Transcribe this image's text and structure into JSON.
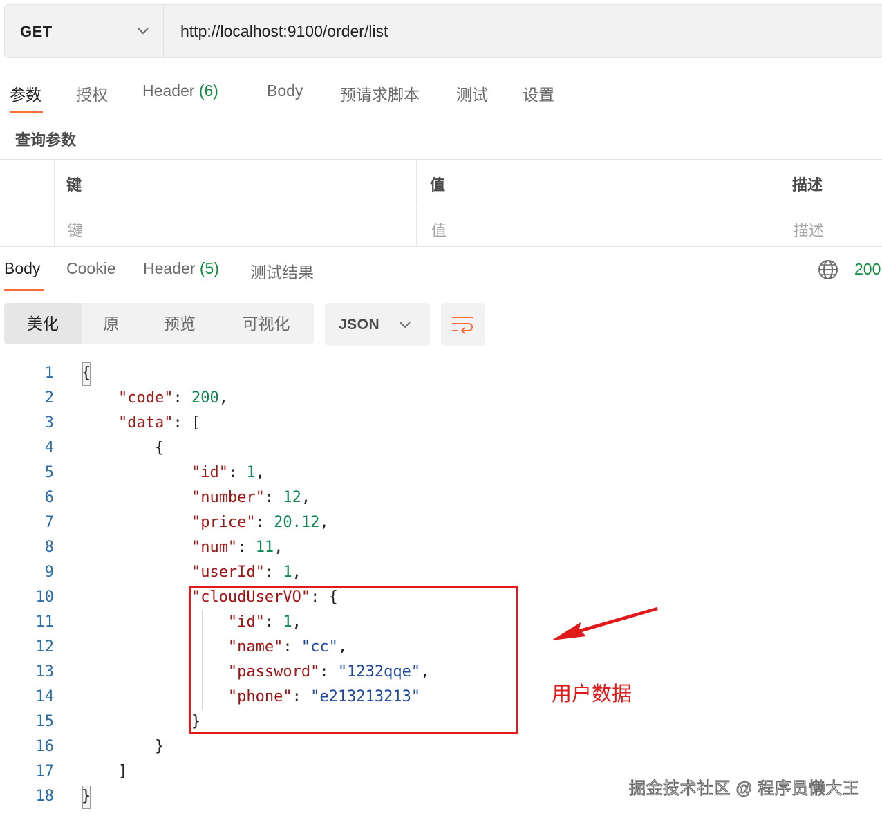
{
  "request": {
    "method": "GET",
    "url": "http://localhost:9100/order/list",
    "tabs": [
      {
        "label": "参数"
      },
      {
        "label": "授权"
      },
      {
        "label": "Header",
        "count": "(6)"
      },
      {
        "label": "Body"
      },
      {
        "label": "预请求脚本"
      },
      {
        "label": "测试"
      },
      {
        "label": "设置"
      }
    ],
    "active_tab": "参数"
  },
  "params": {
    "title": "查询参数",
    "headers": [
      "键",
      "值",
      "描述"
    ],
    "placeholders": [
      "键",
      "值",
      "描述"
    ]
  },
  "response": {
    "tabs": [
      {
        "label": "Body"
      },
      {
        "label": "Cookie"
      },
      {
        "label": "Header",
        "count": "(5)"
      },
      {
        "label": "测试结果"
      }
    ],
    "active_tab": "Body",
    "status": "200",
    "view_modes": [
      "美化",
      "原",
      "预览",
      "可视化"
    ],
    "active_view_mode": "美化",
    "format": "JSON",
    "icons": [
      "globe-icon",
      "chevron-down-icon",
      "wrap-lines-icon"
    ],
    "code_lines": [
      {
        "n": "1",
        "text": "{"
      },
      {
        "n": "2",
        "text": "    \"code\": 200,"
      },
      {
        "n": "3",
        "text": "    \"data\": ["
      },
      {
        "n": "4",
        "text": "        {"
      },
      {
        "n": "5",
        "text": "            \"id\": 1,"
      },
      {
        "n": "6",
        "text": "            \"number\": 12,"
      },
      {
        "n": "7",
        "text": "            \"price\": 20.12,"
      },
      {
        "n": "8",
        "text": "            \"num\": 11,"
      },
      {
        "n": "9",
        "text": "            \"userId\": 1,"
      },
      {
        "n": "10",
        "text": "            \"cloudUserVO\": {"
      },
      {
        "n": "11",
        "text": "                \"id\": 1,"
      },
      {
        "n": "12",
        "text": "                \"name\": \"cc\","
      },
      {
        "n": "13",
        "text": "                \"password\": \"1232qqe\","
      },
      {
        "n": "14",
        "text": "                \"phone\": \"e213213213\""
      },
      {
        "n": "15",
        "text": "            }"
      },
      {
        "n": "16",
        "text": "        }"
      },
      {
        "n": "17",
        "text": "    ]"
      },
      {
        "n": "18",
        "text": "}"
      }
    ]
  },
  "annotation": {
    "label": "用户数据",
    "color": "#e01a1a"
  },
  "watermark": "掘金技术社区 @ 程序员懒大王",
  "colors": {
    "accent": "#ff6c37",
    "count_green": "#0f8a3f",
    "json_key": "#a31515",
    "json_string": "#1f47a0",
    "json_number": "#108550",
    "line_number": "#2b6ea8"
  }
}
